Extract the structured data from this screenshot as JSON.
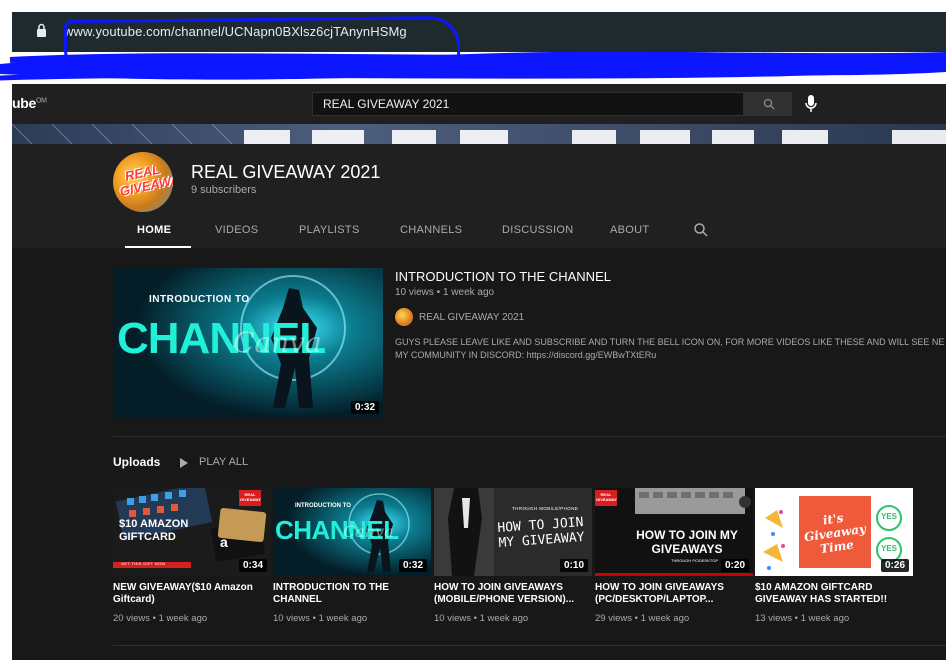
{
  "browser": {
    "url_host": "www.youtube.com",
    "url_path": "/channel/UCNapn0BXlsz6cjTAnynHSMg"
  },
  "youtube": {
    "logo_text": "ube",
    "logo_sup": "OM",
    "search_value": "REAL GIVEAWAY 2021"
  },
  "channel": {
    "name": "REAL GIVEAWAY 2021",
    "subscribers": "9 subscribers",
    "avatar_text": "REAL GIVEAWAY",
    "tabs": [
      {
        "label": "HOME"
      },
      {
        "label": "VIDEOS"
      },
      {
        "label": "PLAYLISTS"
      },
      {
        "label": "CHANNELS"
      },
      {
        "label": "DISCUSSION"
      },
      {
        "label": "ABOUT"
      }
    ]
  },
  "featured": {
    "thumb_top": "INTRODUCTION TO",
    "thumb_big": "CHANNEL",
    "thumb_watermark": "Canva",
    "duration": "0:32",
    "title": "INTRODUCTION TO THE CHANNEL",
    "meta": "10 views • 1 week ago",
    "channel": "REAL GIVEAWAY 2021",
    "description": "GUYS PLEASE LEAVE LIKE AND SUBSCRIBE AND TURN THE BELL ICON ON, FOR MORE VIDEOS LIKE THESE AND WILL SEE NE MY COMMUNITY IN DISCORD: https://discord.gg/EWBwTXtERu"
  },
  "uploads": {
    "title": "Uploads",
    "play_all": "PLAY ALL",
    "items": [
      {
        "title": "NEW GIVEAWAY($10 Amazon Giftcard)",
        "meta": "20 views • 1 week ago",
        "duration": "0:34",
        "thumb_text": "$10 AMAZON GIFTCARD",
        "thumb_badge": "REAL GIVEAWAY",
        "thumb_ribbon": "GET THIS GIFT NOW",
        "thumb_card": "a"
      },
      {
        "title": "INTRODUCTION TO THE CHANNEL",
        "meta": "10 views • 1 week ago",
        "duration": "0:32",
        "thumb_top": "INTRODUCTION TO",
        "thumb_big": "CHANNEL",
        "thumb_watermark": "Canva"
      },
      {
        "title": "HOW TO JOIN GIVEAWAYS (MOBILE/PHONE VERSION)...",
        "meta": "10 views • 1 week ago",
        "duration": "0:10",
        "thumb_small": "THROUGH MOBILE/PHONE",
        "thumb_big": "HOW TO JOIN MY GIVEAWAY"
      },
      {
        "title": "HOW TO JOIN GIVEAWAYS (PC/DESKTOP/LAPTOP...",
        "meta": "29 views • 1 week ago",
        "duration": "0:20",
        "thumb_big": "HOW TO JOIN MY GIVEAWAYS",
        "thumb_small": "THROUGH PC/DESKTOP",
        "thumb_badge": "REAL GIVEAWAY"
      },
      {
        "title": "$10 AMAZON GIFTCARD GIVEAWAY HAS STARTED!!",
        "meta": "13 views • 1 week ago",
        "duration": "0:26",
        "thumb_big": "it's Giveaway Time",
        "thumb_yes": "YES"
      }
    ]
  },
  "colors": {
    "app_bg": "#181818",
    "header_bg": "#202020",
    "scribble": "#0d17ff",
    "accent_red": "#cc0000",
    "cyan": "#1ee3e0"
  }
}
